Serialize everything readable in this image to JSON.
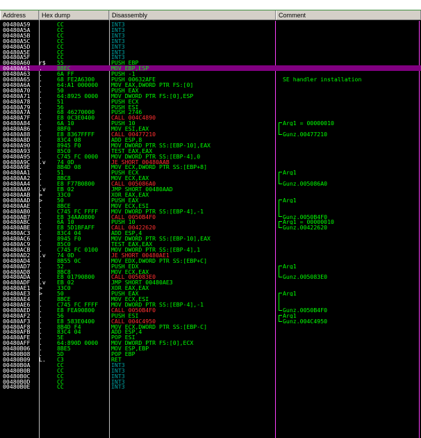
{
  "columns": {
    "address": "Address",
    "hex": "Hex dump",
    "disassembly": "Disassembly",
    "comment": "Comment"
  },
  "colors": {
    "background": "#000000",
    "code_text": "#00ff00",
    "call_jump_text": "#ff3030",
    "selection": "#800080",
    "comment_border": "#ff40ff"
  },
  "rows": [
    {
      "a": "00480A59",
      "m": "",
      "h": "CC",
      "d": "INT3",
      "s": "gray"
    },
    {
      "a": "00480A5A",
      "m": "",
      "h": "CC",
      "d": "INT3",
      "s": "gray"
    },
    {
      "a": "00480A5B",
      "m": "",
      "h": "CC",
      "d": "INT3",
      "s": "gray"
    },
    {
      "a": "00480A5C",
      "m": "",
      "h": "CC",
      "d": "INT3",
      "s": "gray"
    },
    {
      "a": "00480A5D",
      "m": "",
      "h": "CC",
      "d": "INT3",
      "s": "gray"
    },
    {
      "a": "00480A5E",
      "m": "",
      "h": "CC",
      "d": "INT3",
      "s": "gray"
    },
    {
      "a": "00480A5F",
      "m": "",
      "h": "CC",
      "d": "INT3",
      "s": "gray"
    },
    {
      "a": "00480A60",
      "m": "r$",
      "h": "55",
      "d": "PUSH EBP",
      "s": ""
    },
    {
      "a": "00480A61",
      "m": ".",
      "h": "8BEC",
      "d": "MOV EBP,ESP",
      "s": "sel"
    },
    {
      "a": "00480A63",
      "m": ".",
      "h": "6A FF",
      "d": "PUSH -1",
      "s": ""
    },
    {
      "a": "00480A65",
      "m": ".",
      "h": "68 FE2A6300",
      "d": "PUSH 00632AFE",
      "s": "",
      "c": "SE handler installation"
    },
    {
      "a": "00480A6A",
      "m": ".",
      "h": "64:A1 000000",
      "d": "MOV EAX,DWORD PTR FS:[0]",
      "s": ""
    },
    {
      "a": "00480A70",
      "m": ".",
      "h": "50",
      "d": "PUSH EAX",
      "s": ""
    },
    {
      "a": "00480A71",
      "m": ".",
      "h": "64:8925 0000",
      "d": "MOV DWORD PTR FS:[0],ESP",
      "s": ""
    },
    {
      "a": "00480A78",
      "m": ".",
      "h": "51",
      "d": "PUSH ECX",
      "s": ""
    },
    {
      "a": "00480A79",
      "m": ".",
      "h": "56",
      "d": "PUSH ESI",
      "s": ""
    },
    {
      "a": "00480A7A",
      "m": ".",
      "h": "68 46270000",
      "d": "PUSH 2746",
      "s": ""
    },
    {
      "a": "00480A7F",
      "m": ".",
      "h": "E8 0C3E0400",
      "d": "CALL 004C4890",
      "s": "red"
    },
    {
      "a": "00480A84",
      "m": ".",
      "h": "6A 10",
      "d": "PUSH 10",
      "s": "",
      "c": "Arg1 = 00000010"
    },
    {
      "a": "00480A86",
      "m": ".",
      "h": "8BF0",
      "d": "MOV ESI,EAX",
      "s": ""
    },
    {
      "a": "00480A88",
      "m": ".",
      "h": "E8 8367FFFF",
      "d": "CALL 00477210",
      "s": "red",
      "c": "Gunz.00477210"
    },
    {
      "a": "00480A8D",
      "m": ".",
      "h": "83C4 08",
      "d": "ADD ESP,8",
      "s": ""
    },
    {
      "a": "00480A90",
      "m": ".",
      "h": "8945 F0",
      "d": "MOV DWORD PTR SS:[EBP-10],EAX",
      "s": ""
    },
    {
      "a": "00480A93",
      "m": ".",
      "h": "85C0",
      "d": "TEST EAX,EAX",
      "s": ""
    },
    {
      "a": "00480A95",
      "m": ".",
      "h": "C745 FC 0000",
      "d": "MOV DWORD PTR SS:[EBP-4],0",
      "s": ""
    },
    {
      "a": "00480A9C",
      "m": ".v",
      "h": "74 0D",
      "d": "JE SHORT 00480AAB",
      "s": "red"
    },
    {
      "a": "00480A9E",
      "m": ".",
      "h": "8B4D 08",
      "d": "MOV ECX,DWORD PTR SS:[EBP+8]",
      "s": ""
    },
    {
      "a": "00480AA1",
      "m": ".",
      "h": "51",
      "d": "PUSH ECX",
      "s": "",
      "c": "Arg1"
    },
    {
      "a": "00480AA2",
      "m": ".",
      "h": "8BC8",
      "d": "MOV ECX,EAX",
      "s": ""
    },
    {
      "a": "00480AA4",
      "m": ".",
      "h": "E8 F77B0800",
      "d": "CALL 005086A0",
      "s": "red",
      "c": "Gunz.005086A0"
    },
    {
      "a": "00480AA9",
      "m": ".v",
      "h": "EB 02",
      "d": "JMP SHORT 00480AAD",
      "s": ""
    },
    {
      "a": "00480AAB",
      "m": ">",
      "h": "33C0",
      "d": "XOR EAX,EAX",
      "s": ""
    },
    {
      "a": "00480AAD",
      "m": ">",
      "h": "50",
      "d": "PUSH EAX",
      "s": "",
      "c": "Arg1"
    },
    {
      "a": "00480AAE",
      "m": ".",
      "h": "8BCE",
      "d": "MOV ECX,ESI",
      "s": ""
    },
    {
      "a": "00480AB0",
      "m": ".",
      "h": "C745 FC FFFF",
      "d": "MOV DWORD PTR SS:[EBP-4],-1",
      "s": ""
    },
    {
      "a": "00480AB7",
      "m": ".",
      "h": "E8 34AA0800",
      "d": "CALL 0050B4F0",
      "s": "red",
      "c": "Gunz.0050B4F0"
    },
    {
      "a": "00480ABC",
      "m": ".",
      "h": "6A 10",
      "d": "PUSH 10",
      "s": "",
      "c": "Arg1 = 00000010"
    },
    {
      "a": "00480ABE",
      "m": ".",
      "h": "E8 5D1BFAFF",
      "d": "CALL 00422620",
      "s": "red",
      "c": "Gunz.00422620"
    },
    {
      "a": "00480AC3",
      "m": ".",
      "h": "83C4 04",
      "d": "ADD ESP,4",
      "s": ""
    },
    {
      "a": "00480AC6",
      "m": ".",
      "h": "8945 F0",
      "d": "MOV DWORD PTR SS:[EBP-10],EAX",
      "s": ""
    },
    {
      "a": "00480AC9",
      "m": ".",
      "h": "85C0",
      "d": "TEST EAX,EAX",
      "s": ""
    },
    {
      "a": "00480ACB",
      "m": ".",
      "h": "C745 FC 0100",
      "d": "MOV DWORD PTR SS:[EBP-4],1",
      "s": ""
    },
    {
      "a": "00480AD2",
      "m": ".v",
      "h": "74 0D",
      "d": "JE SHORT 00480AE1",
      "s": "red"
    },
    {
      "a": "00480AD4",
      "m": ".",
      "h": "8B55 0C",
      "d": "MOV EDX,DWORD PTR SS:[EBP+C]",
      "s": ""
    },
    {
      "a": "00480AD7",
      "m": ".",
      "h": "52",
      "d": "PUSH EDX",
      "s": "",
      "c": "Arg1"
    },
    {
      "a": "00480AD8",
      "m": ".",
      "h": "8BC8",
      "d": "MOV ECX,EAX",
      "s": ""
    },
    {
      "a": "00480ADA",
      "m": ".",
      "h": "E8 01790800",
      "d": "CALL 005083E0",
      "s": "red",
      "c": "Gunz.005083E0"
    },
    {
      "a": "00480ADF",
      "m": ".v",
      "h": "EB 02",
      "d": "JMP SHORT 00480AE3",
      "s": ""
    },
    {
      "a": "00480AE1",
      "m": ">",
      "h": "33C0",
      "d": "XOR EAX,EAX",
      "s": ""
    },
    {
      "a": "00480AE3",
      "m": ">",
      "h": "50",
      "d": "PUSH EAX",
      "s": "",
      "c": "Arg1"
    },
    {
      "a": "00480AE4",
      "m": ".",
      "h": "8BCE",
      "d": "MOV ECX,ESI",
      "s": ""
    },
    {
      "a": "00480AE6",
      "m": ".",
      "h": "C745 FC FFFF",
      "d": "MOV DWORD PTR SS:[EBP-4],-1",
      "s": ""
    },
    {
      "a": "00480AED",
      "m": ".",
      "h": "E8 FEA90800",
      "d": "CALL 0050B4F0",
      "s": "red",
      "c": "Gunz.0050B4F0"
    },
    {
      "a": "00480AF2",
      "m": ".",
      "h": "56",
      "d": "PUSH ESI",
      "s": "",
      "c": "Arg1"
    },
    {
      "a": "00480AF3",
      "m": ".",
      "h": "E8 583E0400",
      "d": "CALL 004C4950",
      "s": "red",
      "c": "Gunz.004C4950"
    },
    {
      "a": "00480AF8",
      "m": ".",
      "h": "8B4D F4",
      "d": "MOV ECX,DWORD PTR SS:[EBP-C]",
      "s": ""
    },
    {
      "a": "00480AFB",
      "m": ".",
      "h": "83C4 04",
      "d": "ADD ESP,4",
      "s": ""
    },
    {
      "a": "00480AFE",
      "m": ".",
      "h": "5E",
      "d": "POP ESI",
      "s": ""
    },
    {
      "a": "00480AFF",
      "m": ".",
      "h": "64:890D 0000",
      "d": "MOV DWORD PTR FS:[0],ECX",
      "s": ""
    },
    {
      "a": "00480B06",
      "m": ".",
      "h": "8BE5",
      "d": "MOV ESP,EBP",
      "s": ""
    },
    {
      "a": "00480B08",
      "m": ".",
      "h": "5D",
      "d": "POP EBP",
      "s": ""
    },
    {
      "a": "00480B09",
      "m": "L.",
      "h": "C3",
      "d": "RET",
      "s": ""
    },
    {
      "a": "00480B0A",
      "m": "",
      "h": "CC",
      "d": "INT3",
      "s": "gray"
    },
    {
      "a": "00480B0B",
      "m": "",
      "h": "CC",
      "d": "INT3",
      "s": "gray"
    },
    {
      "a": "00480B0C",
      "m": "",
      "h": "CC",
      "d": "INT3",
      "s": "gray"
    },
    {
      "a": "00480B0D",
      "m": "",
      "h": "CC",
      "d": "INT3",
      "s": "gray"
    },
    {
      "a": "00480B0E",
      "m": "",
      "h": "CC",
      "d": "INT3",
      "s": "gray"
    }
  ]
}
